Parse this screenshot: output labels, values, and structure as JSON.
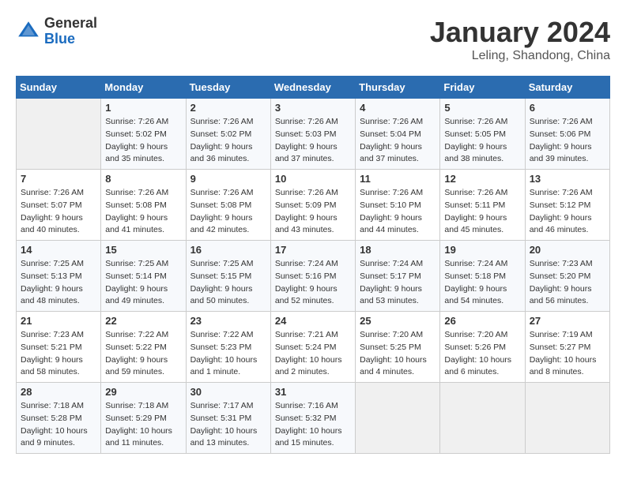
{
  "header": {
    "logo_general": "General",
    "logo_blue": "Blue",
    "month_title": "January 2024",
    "location": "Leling, Shandong, China"
  },
  "days_of_week": [
    "Sunday",
    "Monday",
    "Tuesday",
    "Wednesday",
    "Thursday",
    "Friday",
    "Saturday"
  ],
  "weeks": [
    [
      {
        "day": "",
        "sunrise": "",
        "sunset": "",
        "daylight": ""
      },
      {
        "day": "1",
        "sunrise": "Sunrise: 7:26 AM",
        "sunset": "Sunset: 5:02 PM",
        "daylight": "Daylight: 9 hours and 35 minutes."
      },
      {
        "day": "2",
        "sunrise": "Sunrise: 7:26 AM",
        "sunset": "Sunset: 5:02 PM",
        "daylight": "Daylight: 9 hours and 36 minutes."
      },
      {
        "day": "3",
        "sunrise": "Sunrise: 7:26 AM",
        "sunset": "Sunset: 5:03 PM",
        "daylight": "Daylight: 9 hours and 37 minutes."
      },
      {
        "day": "4",
        "sunrise": "Sunrise: 7:26 AM",
        "sunset": "Sunset: 5:04 PM",
        "daylight": "Daylight: 9 hours and 37 minutes."
      },
      {
        "day": "5",
        "sunrise": "Sunrise: 7:26 AM",
        "sunset": "Sunset: 5:05 PM",
        "daylight": "Daylight: 9 hours and 38 minutes."
      },
      {
        "day": "6",
        "sunrise": "Sunrise: 7:26 AM",
        "sunset": "Sunset: 5:06 PM",
        "daylight": "Daylight: 9 hours and 39 minutes."
      }
    ],
    [
      {
        "day": "7",
        "sunrise": "Sunrise: 7:26 AM",
        "sunset": "Sunset: 5:07 PM",
        "daylight": "Daylight: 9 hours and 40 minutes."
      },
      {
        "day": "8",
        "sunrise": "Sunrise: 7:26 AM",
        "sunset": "Sunset: 5:08 PM",
        "daylight": "Daylight: 9 hours and 41 minutes."
      },
      {
        "day": "9",
        "sunrise": "Sunrise: 7:26 AM",
        "sunset": "Sunset: 5:08 PM",
        "daylight": "Daylight: 9 hours and 42 minutes."
      },
      {
        "day": "10",
        "sunrise": "Sunrise: 7:26 AM",
        "sunset": "Sunset: 5:09 PM",
        "daylight": "Daylight: 9 hours and 43 minutes."
      },
      {
        "day": "11",
        "sunrise": "Sunrise: 7:26 AM",
        "sunset": "Sunset: 5:10 PM",
        "daylight": "Daylight: 9 hours and 44 minutes."
      },
      {
        "day": "12",
        "sunrise": "Sunrise: 7:26 AM",
        "sunset": "Sunset: 5:11 PM",
        "daylight": "Daylight: 9 hours and 45 minutes."
      },
      {
        "day": "13",
        "sunrise": "Sunrise: 7:26 AM",
        "sunset": "Sunset: 5:12 PM",
        "daylight": "Daylight: 9 hours and 46 minutes."
      }
    ],
    [
      {
        "day": "14",
        "sunrise": "Sunrise: 7:25 AM",
        "sunset": "Sunset: 5:13 PM",
        "daylight": "Daylight: 9 hours and 48 minutes."
      },
      {
        "day": "15",
        "sunrise": "Sunrise: 7:25 AM",
        "sunset": "Sunset: 5:14 PM",
        "daylight": "Daylight: 9 hours and 49 minutes."
      },
      {
        "day": "16",
        "sunrise": "Sunrise: 7:25 AM",
        "sunset": "Sunset: 5:15 PM",
        "daylight": "Daylight: 9 hours and 50 minutes."
      },
      {
        "day": "17",
        "sunrise": "Sunrise: 7:24 AM",
        "sunset": "Sunset: 5:16 PM",
        "daylight": "Daylight: 9 hours and 52 minutes."
      },
      {
        "day": "18",
        "sunrise": "Sunrise: 7:24 AM",
        "sunset": "Sunset: 5:17 PM",
        "daylight": "Daylight: 9 hours and 53 minutes."
      },
      {
        "day": "19",
        "sunrise": "Sunrise: 7:24 AM",
        "sunset": "Sunset: 5:18 PM",
        "daylight": "Daylight: 9 hours and 54 minutes."
      },
      {
        "day": "20",
        "sunrise": "Sunrise: 7:23 AM",
        "sunset": "Sunset: 5:20 PM",
        "daylight": "Daylight: 9 hours and 56 minutes."
      }
    ],
    [
      {
        "day": "21",
        "sunrise": "Sunrise: 7:23 AM",
        "sunset": "Sunset: 5:21 PM",
        "daylight": "Daylight: 9 hours and 58 minutes."
      },
      {
        "day": "22",
        "sunrise": "Sunrise: 7:22 AM",
        "sunset": "Sunset: 5:22 PM",
        "daylight": "Daylight: 9 hours and 59 minutes."
      },
      {
        "day": "23",
        "sunrise": "Sunrise: 7:22 AM",
        "sunset": "Sunset: 5:23 PM",
        "daylight": "Daylight: 10 hours and 1 minute."
      },
      {
        "day": "24",
        "sunrise": "Sunrise: 7:21 AM",
        "sunset": "Sunset: 5:24 PM",
        "daylight": "Daylight: 10 hours and 2 minutes."
      },
      {
        "day": "25",
        "sunrise": "Sunrise: 7:20 AM",
        "sunset": "Sunset: 5:25 PM",
        "daylight": "Daylight: 10 hours and 4 minutes."
      },
      {
        "day": "26",
        "sunrise": "Sunrise: 7:20 AM",
        "sunset": "Sunset: 5:26 PM",
        "daylight": "Daylight: 10 hours and 6 minutes."
      },
      {
        "day": "27",
        "sunrise": "Sunrise: 7:19 AM",
        "sunset": "Sunset: 5:27 PM",
        "daylight": "Daylight: 10 hours and 8 minutes."
      }
    ],
    [
      {
        "day": "28",
        "sunrise": "Sunrise: 7:18 AM",
        "sunset": "Sunset: 5:28 PM",
        "daylight": "Daylight: 10 hours and 9 minutes."
      },
      {
        "day": "29",
        "sunrise": "Sunrise: 7:18 AM",
        "sunset": "Sunset: 5:29 PM",
        "daylight": "Daylight: 10 hours and 11 minutes."
      },
      {
        "day": "30",
        "sunrise": "Sunrise: 7:17 AM",
        "sunset": "Sunset: 5:31 PM",
        "daylight": "Daylight: 10 hours and 13 minutes."
      },
      {
        "day": "31",
        "sunrise": "Sunrise: 7:16 AM",
        "sunset": "Sunset: 5:32 PM",
        "daylight": "Daylight: 10 hours and 15 minutes."
      },
      {
        "day": "",
        "sunrise": "",
        "sunset": "",
        "daylight": ""
      },
      {
        "day": "",
        "sunrise": "",
        "sunset": "",
        "daylight": ""
      },
      {
        "day": "",
        "sunrise": "",
        "sunset": "",
        "daylight": ""
      }
    ]
  ]
}
